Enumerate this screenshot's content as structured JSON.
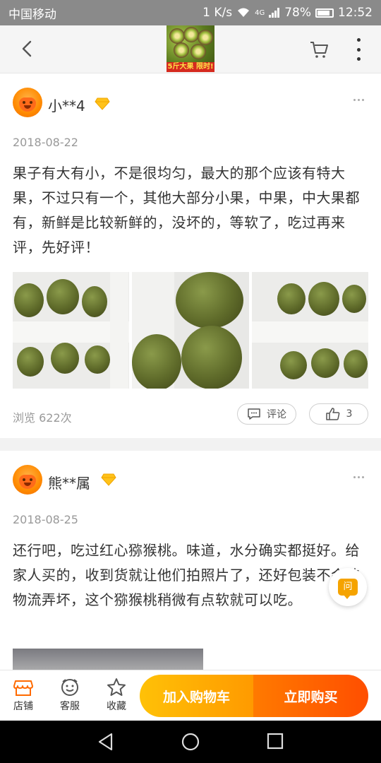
{
  "status_bar": {
    "carrier": "中国移动",
    "speed": "1 K/s",
    "network": "4G",
    "battery": "78%",
    "time": "12:52"
  },
  "header": {
    "thumbnail_banner": "5斤大果 限时!"
  },
  "reviews": [
    {
      "username": "小**4",
      "date": "2018-08-22",
      "text": "果子有大有小，不是很均匀，最大的那个应该有特大果，不过只有一个，其他大部分小果，中果，中大果都有，新鲜是比较新鲜的，没坏的，等软了，吃过再来评，先好评！",
      "views": "浏览 622次",
      "comment_label": "评论",
      "likes": "3"
    },
    {
      "username": "熊**属",
      "date": "2018-08-25",
      "text": "还行吧，吃过红心猕猴桃。味道，水分确实都挺好。给家人买的，收到货就让他们拍照片了，还好包装不会被物流弄坏，这个猕猴桃稍微有点软就可以吃。"
    }
  ],
  "floating_button": {
    "label": "问"
  },
  "bottom_bar": {
    "store": "店铺",
    "service": "客服",
    "favorite": "收藏",
    "add_to_cart": "加入购物车",
    "buy_now": "立即购买"
  },
  "colors": {
    "accent_yellow": "#ffb300",
    "accent_orange": "#ff5500"
  }
}
